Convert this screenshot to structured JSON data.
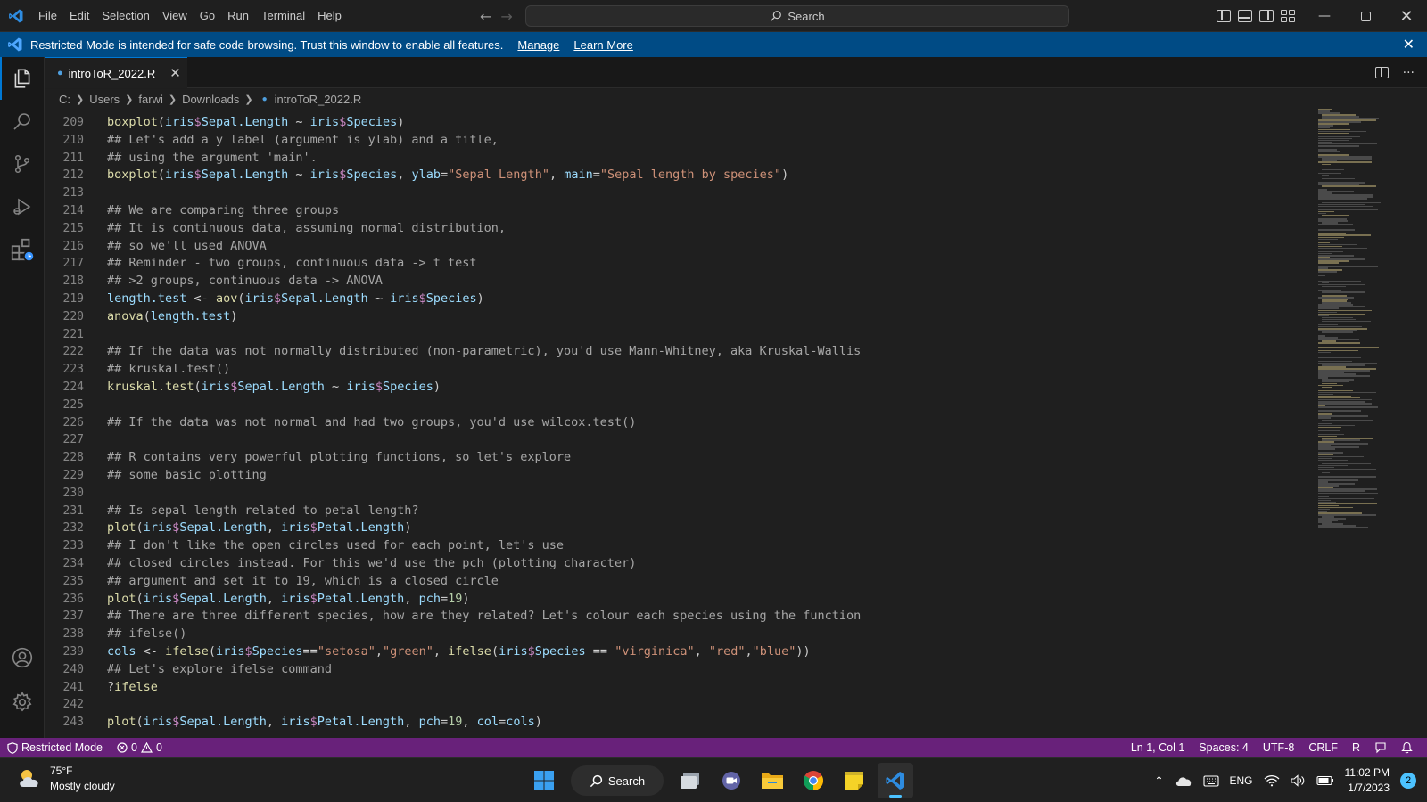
{
  "titlebar": {
    "menu": [
      "File",
      "Edit",
      "Selection",
      "View",
      "Go",
      "Run",
      "Terminal",
      "Help"
    ],
    "search_label": "Search"
  },
  "banner": {
    "message": "Restricted Mode is intended for safe code browsing. Trust this window to enable all features.",
    "manage": "Manage",
    "learn_more": "Learn More"
  },
  "tab": {
    "label": "introToR_2022.R"
  },
  "breadcrumb": [
    "C:",
    "Users",
    "farwi",
    "Downloads",
    "introToR_2022.R"
  ],
  "editor": {
    "line_numbers": [
      "209",
      "210",
      "211",
      "212",
      "213",
      "214",
      "215",
      "216",
      "217",
      "218",
      "219",
      "220",
      "221",
      "222",
      "223",
      "224",
      "225",
      "226",
      "227",
      "228",
      "229",
      "230",
      "231",
      "232",
      "233",
      "234",
      "235",
      "236",
      "237",
      "238",
      "239",
      "240",
      "241",
      "242",
      "243"
    ],
    "comments": {
      "c210": "## Let's add a y label (argument is ylab) and a title,",
      "c211": "## using the argument 'main'.",
      "c214": "## We are comparing three groups",
      "c215": "## It is continuous data, assuming normal distribution,",
      "c216": "## so we'll used ANOVA",
      "c217": "## Reminder - two groups, continuous data -> t test",
      "c218": "## >2 groups, continuous data -> ANOVA",
      "c222": "## If the data was not normally distributed (non-parametric), you'd use Mann-Whitney, aka Kruskal-Wallis",
      "c223": "## kruskal.test()",
      "c226": "## If the data was not normal and had two groups, you'd use wilcox.test()",
      "c228": "## R contains very powerful plotting functions, so let's explore",
      "c229": "## some basic plotting",
      "c231": "## Is sepal length related to petal length?",
      "c233": "## I don't like the open circles used for each point, let's use",
      "c234": "## closed circles instead. For this we'd use the pch (plotting character)",
      "c235": "## argument and set it to 19, which is a closed circle",
      "c237": "## There are three different species, how are they related? Let's colour each species using the function",
      "c238": "## ifelse()",
      "c240": "## Let's explore ifelse command"
    },
    "strings": {
      "sepal_length": "\"Sepal Length\"",
      "sepal_by_species": "\"Sepal length by species\"",
      "setosa": "\"setosa\"",
      "green": "\"green\"",
      "virginica": "\"virginica\"",
      "red": "\"red\"",
      "blue": "\"blue\""
    }
  },
  "statusbar": {
    "restricted": "Restricted Mode",
    "errors": "0",
    "warnings": "0",
    "position": "Ln 1, Col 1",
    "spaces": "Spaces: 4",
    "encoding": "UTF-8",
    "eol": "CRLF",
    "language": "R"
  },
  "taskbar": {
    "temperature": "75°F",
    "weather": "Mostly cloudy",
    "search": "Search",
    "language": "ENG",
    "time": "11:02 PM",
    "date": "1/7/2023",
    "notifications": "2"
  },
  "colors": {
    "banner": "#004b85",
    "statusbar": "#68217a",
    "accent": "#0078d4"
  }
}
